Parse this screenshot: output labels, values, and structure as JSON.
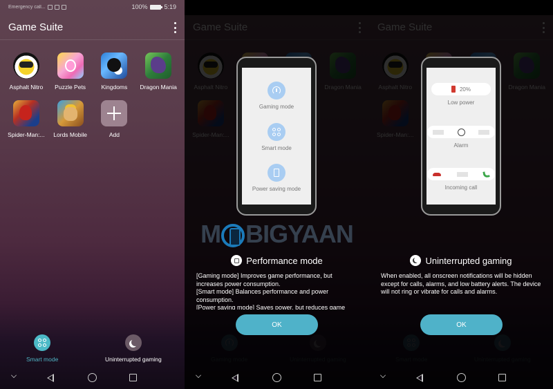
{
  "statusbar": {
    "carrier": "Emergency call...",
    "battery": "100%",
    "time": "5:19"
  },
  "header": {
    "title": "Game Suite",
    "menu_icon": "more-vert-icon"
  },
  "games": [
    {
      "label": "Asphalt Nitro",
      "icon": "asphalt-nitro-icon"
    },
    {
      "label": "Puzzle Pets",
      "icon": "puzzle-pets-icon"
    },
    {
      "label": "Kingdoms",
      "icon": "kingdoms-icon"
    },
    {
      "label": "Dragon Mania",
      "icon": "dragon-mania-icon"
    },
    {
      "label": "Spider-Man:...",
      "icon": "spider-man-icon"
    },
    {
      "label": "Lords Mobile",
      "icon": "lords-mobile-icon"
    },
    {
      "label": "Add",
      "icon": "plus-icon"
    }
  ],
  "bottom_modes": {
    "screen1": [
      {
        "label": "Smart mode",
        "icon": "smart-mode-icon",
        "active": true
      },
      {
        "label": "Uninterrupted gaming",
        "icon": "moon-icon",
        "active": false
      }
    ],
    "screen2": [
      {
        "label": "Gaming mode",
        "icon": "gauge-icon"
      },
      {
        "label": "Uninterrupted gaming",
        "icon": "moon-icon"
      }
    ],
    "screen3": [
      {
        "label": "Smart mode",
        "icon": "smart-mode-icon"
      },
      {
        "label": "Uninterrupted gaming",
        "icon": "moon-icon"
      }
    ]
  },
  "performance_dialog": {
    "title": "Performance mode",
    "illustration_modes": [
      "Gaming mode",
      "Smart mode",
      "Power saving mode"
    ],
    "body": [
      "[Gaming mode] Improves game performance, but increases power consumption.",
      "[Smart mode] Balances performance and power consumption.",
      "[Power saving mode] Saves power, but reduces game"
    ],
    "ok_label": "OK"
  },
  "uninterrupted_dialog": {
    "title": "Uninterrupted gaming",
    "illustration": {
      "battery_percent": "20%",
      "low_power_label": "Low power",
      "alarm_label": "Alarm",
      "incoming_call_label": "Incoming call"
    },
    "body": "When enabled, all onscreen notifications will be hidden except for calls, alarms, and low battery alerts. The device will not ring or vibrate for calls and alarms.",
    "ok_label": "OK"
  },
  "watermark": {
    "pre": "M",
    "post": "BIGYAAN"
  },
  "colors": {
    "accent": "#4fb2c9",
    "background_top": "#5f4350",
    "background_bottom": "#120a16",
    "mode_bubble": "#a9cdf2",
    "low_battery": "#d13a30",
    "call_accept": "#3ca64a",
    "call_reject": "#c9302c"
  }
}
